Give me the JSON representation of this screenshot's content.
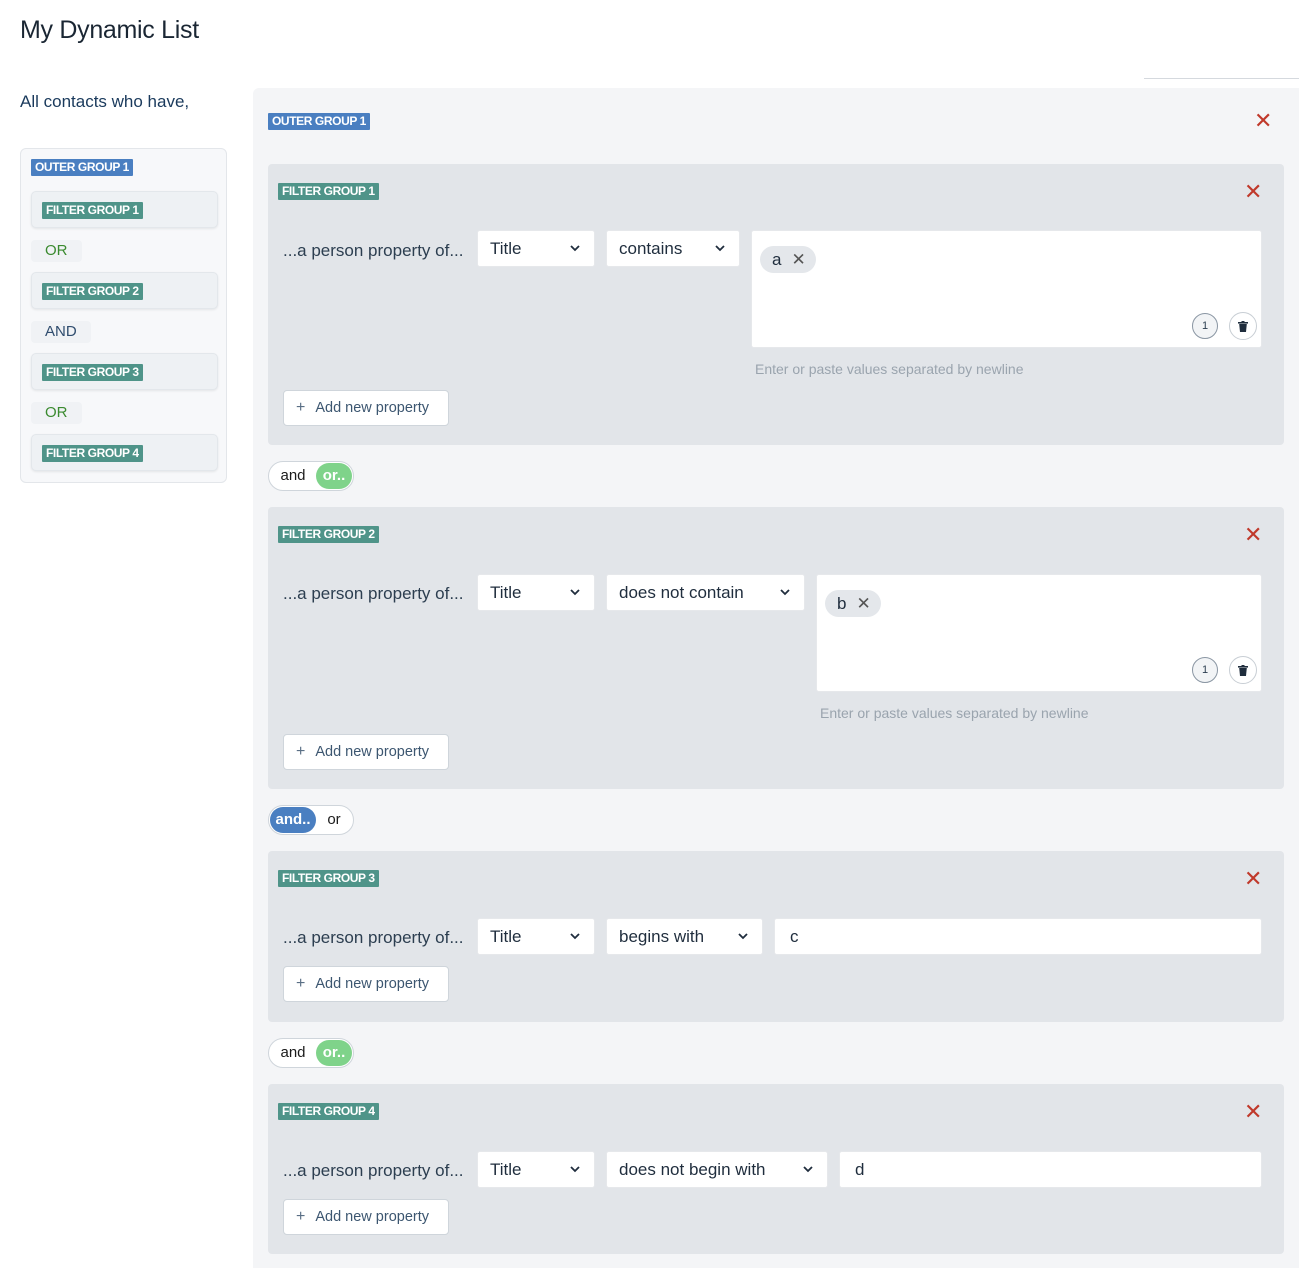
{
  "page": {
    "title": "My Dynamic List",
    "intro": "All contacts who have,"
  },
  "summary": {
    "outer_label": "OUTER GROUP 1",
    "items": [
      {
        "label": "FILTER GROUP 1"
      },
      {
        "label": "FILTER GROUP 2"
      },
      {
        "label": "FILTER GROUP 3"
      },
      {
        "label": "FILTER GROUP 4"
      }
    ],
    "connectors": [
      "OR",
      "AND",
      "OR"
    ]
  },
  "outer": {
    "label": "OUTER GROUP 1",
    "close": "✕"
  },
  "groups": [
    {
      "label": "FILTER GROUP 1",
      "close": "✕",
      "row_label": "...a person property of...",
      "property": "Title",
      "operator": "contains",
      "tags": [
        "a"
      ],
      "tag_count": "1",
      "helper": "Enter or paste values separated by newline",
      "add_label": "Add new property"
    },
    {
      "label": "FILTER GROUP 2",
      "close": "✕",
      "row_label": "...a person property of...",
      "property": "Title",
      "operator": "does not contain",
      "tags": [
        "b"
      ],
      "tag_count": "1",
      "helper": "Enter or paste values separated by newline",
      "add_label": "Add new property"
    },
    {
      "label": "FILTER GROUP 3",
      "close": "✕",
      "row_label": "...a person property of...",
      "property": "Title",
      "operator": "begins with",
      "value": "c",
      "add_label": "Add new property"
    },
    {
      "label": "FILTER GROUP 4",
      "close": "✕",
      "row_label": "...a person property of...",
      "property": "Title",
      "operator": "does not begin with",
      "value": "d",
      "add_label": "Add new property"
    }
  ],
  "toggles": [
    {
      "and_label": "and",
      "or_label": "or..",
      "active": "or"
    },
    {
      "and_label": "and..",
      "or_label": "or",
      "active": "and"
    },
    {
      "and_label": "and",
      "or_label": "or..",
      "active": "or"
    }
  ],
  "colors": {
    "outer_badge": "#4a7fc1",
    "group_badge": "#4f9489",
    "close": "#c0392b",
    "or_active": "#7fd38a",
    "and_active": "#4a7fc1"
  },
  "icons": {
    "close": "close-icon",
    "chevron": "chevron-down-icon",
    "trash": "trash-icon",
    "plus": "plus-icon"
  }
}
